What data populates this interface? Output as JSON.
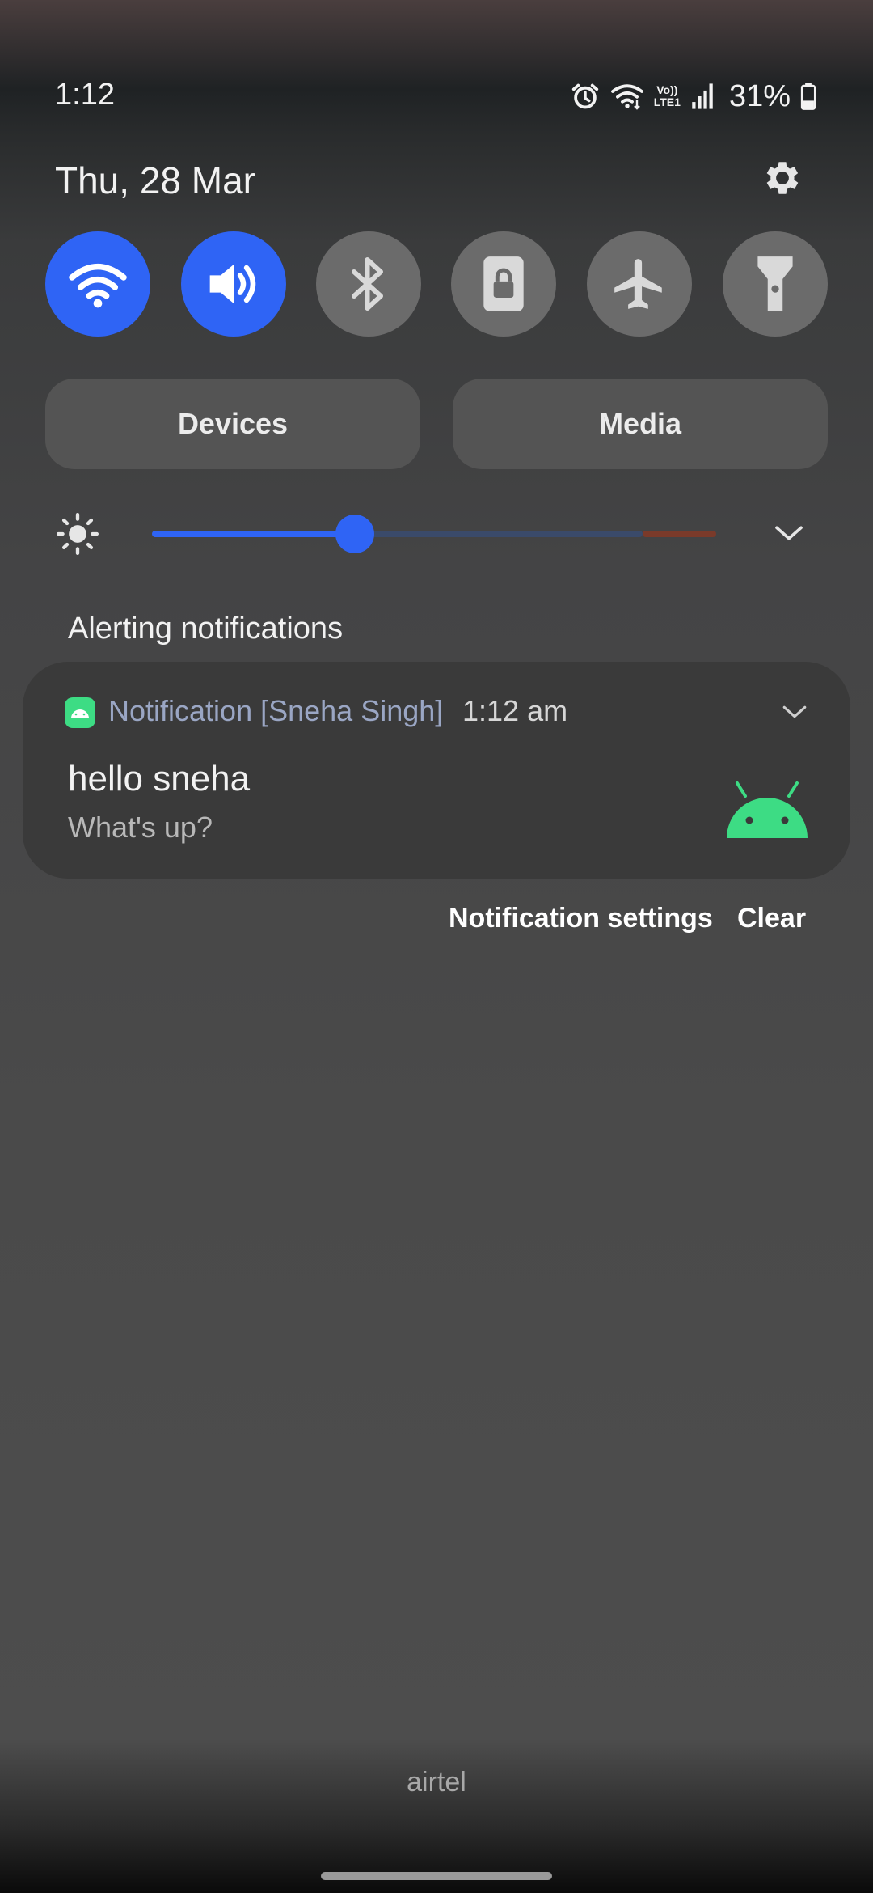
{
  "status_bar": {
    "time": "1:12",
    "icons": [
      "alarm-icon",
      "wifi-icon",
      "volte-icon",
      "signal-icon",
      "battery-icon"
    ],
    "volte_label_top": "Vo))",
    "volte_label_bottom": "LTE1",
    "battery_percent": "31%"
  },
  "header": {
    "date": "Thu, 28 Mar"
  },
  "quick_settings": {
    "tiles": [
      {
        "name": "wifi",
        "icon": "wifi-icon",
        "active": true
      },
      {
        "name": "sound",
        "icon": "speaker-icon",
        "active": true
      },
      {
        "name": "bluetooth",
        "icon": "bluetooth-icon",
        "active": false
      },
      {
        "name": "rotation-lock",
        "icon": "rotation-lock-icon",
        "active": false
      },
      {
        "name": "airplane-mode",
        "icon": "airplane-icon",
        "active": false
      },
      {
        "name": "flashlight",
        "icon": "flashlight-icon",
        "active": false
      }
    ],
    "devices_label": "Devices",
    "media_label": "Media"
  },
  "brightness": {
    "level": 0.36
  },
  "notifications": {
    "section_title": "Alerting notifications",
    "items": [
      {
        "app": "Notification [Sneha Singh]",
        "time": "1:12 am",
        "title": "hello sneha",
        "text": "What's up?"
      }
    ],
    "settings_label": "Notification settings",
    "clear_label": "Clear"
  },
  "footer": {
    "carrier": "airtel"
  },
  "colors": {
    "accent": "#2f64f5",
    "android_green": "#3ddc84",
    "tile_off": "#6b6b6b"
  }
}
